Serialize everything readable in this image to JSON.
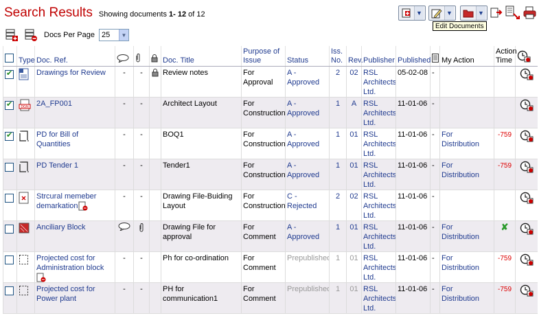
{
  "header": {
    "title": "Search Results",
    "showing_prefix": "Showing documents",
    "showing_range": "1- 12",
    "showing_of": "of 12"
  },
  "toolbar": {
    "tooltip": "Edit Documents",
    "docs_per_page_label": "Docs Per Page",
    "docs_per_page_value": "25"
  },
  "columns": {
    "type": "Type",
    "doc_ref": "Doc. Ref.",
    "doc_title": "Doc. Title",
    "purpose": "Purpose of Issue",
    "status": "Status",
    "iss": "Iss. No.",
    "rev": "Rev.",
    "publisher": "Publisher",
    "published": "Published",
    "my_action": "My Action",
    "action_time": "Action Time"
  },
  "rows": [
    {
      "checked": true,
      "icon": "word-doc-icon",
      "ref": "Drawings for Review",
      "comment": "-",
      "attach": "-",
      "locked": true,
      "title": "Review notes",
      "purpose": "For Approval",
      "status": "A - Approved",
      "status_kind": "normal",
      "iss": "2",
      "rev": "02",
      "publisher": "RSL Architects Ltd.",
      "published": "05-02-08",
      "extra": "-",
      "action": "",
      "time": ""
    },
    {
      "checked": true,
      "icon": "dgn-file-icon",
      "ref": "2A_FP001",
      "comment": "-",
      "attach": "-",
      "locked": false,
      "title": "Architect Layout",
      "purpose": "For Construction",
      "status": "A - Approved",
      "status_kind": "normal",
      "iss": "1",
      "rev": "A",
      "publisher": "RSL Architects Ltd.",
      "published": "11-01-06",
      "extra": "-",
      "action": "",
      "time": ""
    },
    {
      "checked": true,
      "icon": "drawing-frame-icon",
      "ref": "PD for Bill of Quantities",
      "comment": "-",
      "attach": "-",
      "locked": false,
      "title": "BOQ1",
      "purpose": "For Construction",
      "status": "A - Approved",
      "status_kind": "normal",
      "iss": "1",
      "rev": "01",
      "publisher": "RSL Architects Ltd.",
      "published": "11-01-06",
      "extra": "-",
      "action": "For Distribution",
      "time": "-759"
    },
    {
      "checked": false,
      "icon": "drawing-frame-icon",
      "ref": "PD Tender 1",
      "comment": "-",
      "attach": "-",
      "locked": false,
      "title": "Tender1",
      "purpose": "For Construction",
      "status": "A - Approved",
      "status_kind": "normal",
      "iss": "1",
      "rev": "01",
      "publisher": "RSL Architects Ltd.",
      "published": "11-01-06",
      "extra": "-",
      "action": "For Distribution",
      "time": "-759"
    },
    {
      "checked": false,
      "icon": "broken-file-icon",
      "ref": "Strcural memeber demarkation",
      "comment": "-",
      "attach": "-",
      "locked": false,
      "title": "Drawing File-Buiding Layout",
      "purpose": "For Construction",
      "status": "C - Rejected",
      "status_kind": "normal",
      "iss": "2",
      "rev": "02",
      "publisher": "RSL Architects Ltd.",
      "published": "11-01-06",
      "extra": "-",
      "action": "",
      "time": ""
    },
    {
      "checked": false,
      "icon": "red-block-icon",
      "ref": "Anciliary Block",
      "comment": "speech-bubble",
      "attach": "paperclip",
      "locked": false,
      "title": "Drawing File for approval",
      "purpose": "For Comment",
      "status": "A - Approved",
      "status_kind": "normal",
      "iss": "1",
      "rev": "01",
      "publisher": "RSL Architects Ltd.",
      "published": "11-01-06",
      "extra": "-",
      "action": "For Distribution",
      "time": "✘"
    },
    {
      "checked": false,
      "icon": "dashed-frame-icon",
      "ref": "Projected cost for Administration block",
      "comment": "-",
      "attach": "-",
      "locked": false,
      "title": "Ph for co-ordination",
      "purpose": "For Comment",
      "status": "Prepublished",
      "status_kind": "grey",
      "iss": "1",
      "rev": "01",
      "publisher": "RSL Architects Ltd.",
      "published": "11-01-06",
      "extra": "-",
      "action": "For Distribution",
      "time": "-759"
    },
    {
      "checked": false,
      "icon": "dashed-frame-icon",
      "ref": "Projected cost for Power plant",
      "comment": "-",
      "attach": "-",
      "locked": false,
      "title": "PH for communication1",
      "purpose": "For Comment",
      "status": "Prepublished",
      "status_kind": "grey",
      "iss": "1",
      "rev": "01",
      "publisher": "RSL Architects Ltd.",
      "published": "11-01-06",
      "extra": "-",
      "action": "For Distribution",
      "time": "-759"
    }
  ]
}
